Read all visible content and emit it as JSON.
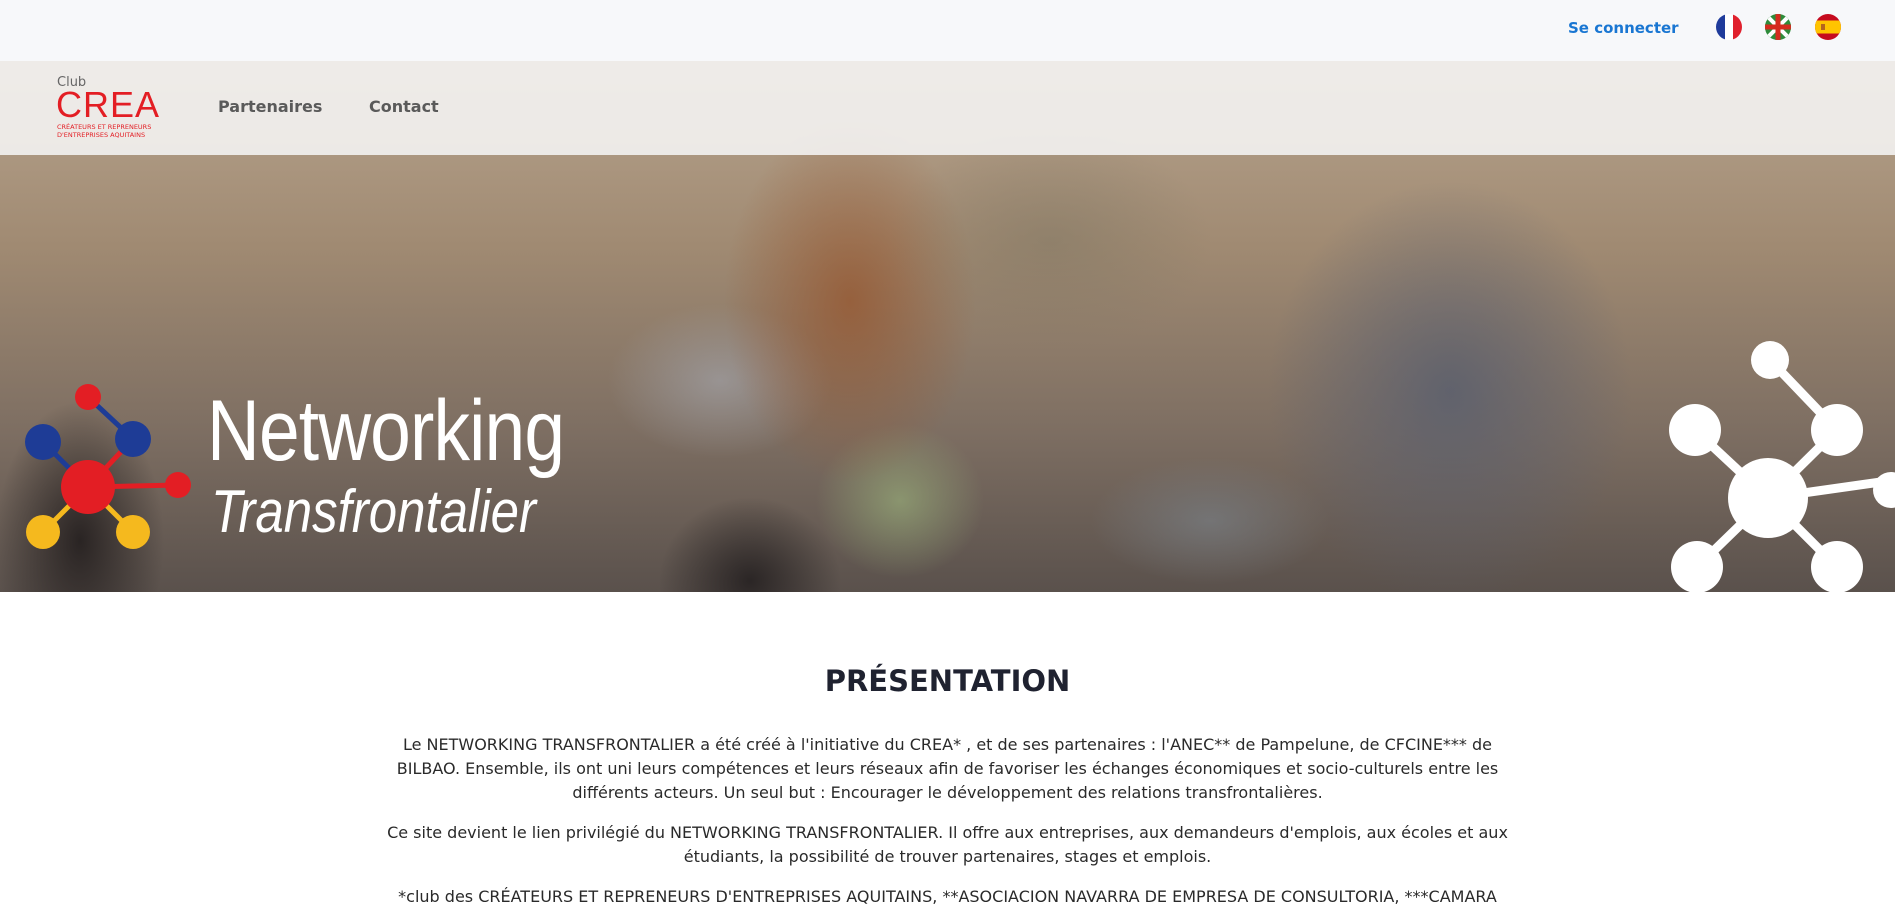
{
  "header": {
    "login_label": "Se connecter",
    "languages": [
      {
        "code": "fr",
        "icon": "french-flag-icon"
      },
      {
        "code": "eu",
        "icon": "basque-flag-icon"
      },
      {
        "code": "es",
        "icon": "spanish-flag-icon"
      }
    ]
  },
  "logo": {
    "club": "Club",
    "name": "CREA",
    "tagline_1": "CRÉATEURS ET REPRENEURS",
    "tagline_2": "D'ENTREPRISES AQUITAINS"
  },
  "nav": {
    "items": [
      {
        "label": "Partenaires"
      },
      {
        "label": "Contact"
      }
    ]
  },
  "hero": {
    "title": "Networking",
    "subtitle": "Transfrontalier"
  },
  "presentation": {
    "title": "PRÉSENTATION",
    "paragraph_1": "Le NETWORKING TRANSFRONTALIER a été créé à l'initiative du CREA* , et de ses partenaires : l'ANEC** de Pampelune, de CFCINE*** de BILBAO. Ensemble, ils ont uni leurs compétences et leurs réseaux afin de favoriser les échanges économiques et socio-culturels entre les différents acteurs. Un seul but : Encourager le développement des relations transfrontalières.",
    "paragraph_2": "Ce site devient le lien privilégié du NETWORKING TRANSFRONTALIER. Il offre aux entreprises, aux demandeurs d'emplois, aux écoles et aux étudiants, la possibilité de trouver partenaires, stages et emplois.",
    "paragraph_3": "*club des CRÉATEURS ET REPRENEURS D'ENTREPRISES AQUITAINS, **ASOCIACION NAVARRA DE EMPRESA DE CONSULTORIA, ***CAMARA"
  },
  "colors": {
    "accent": "#1976d2",
    "brand_red": "#e31e24",
    "logo_blue": "#1e3c96",
    "logo_yellow": "#f5b91e"
  }
}
